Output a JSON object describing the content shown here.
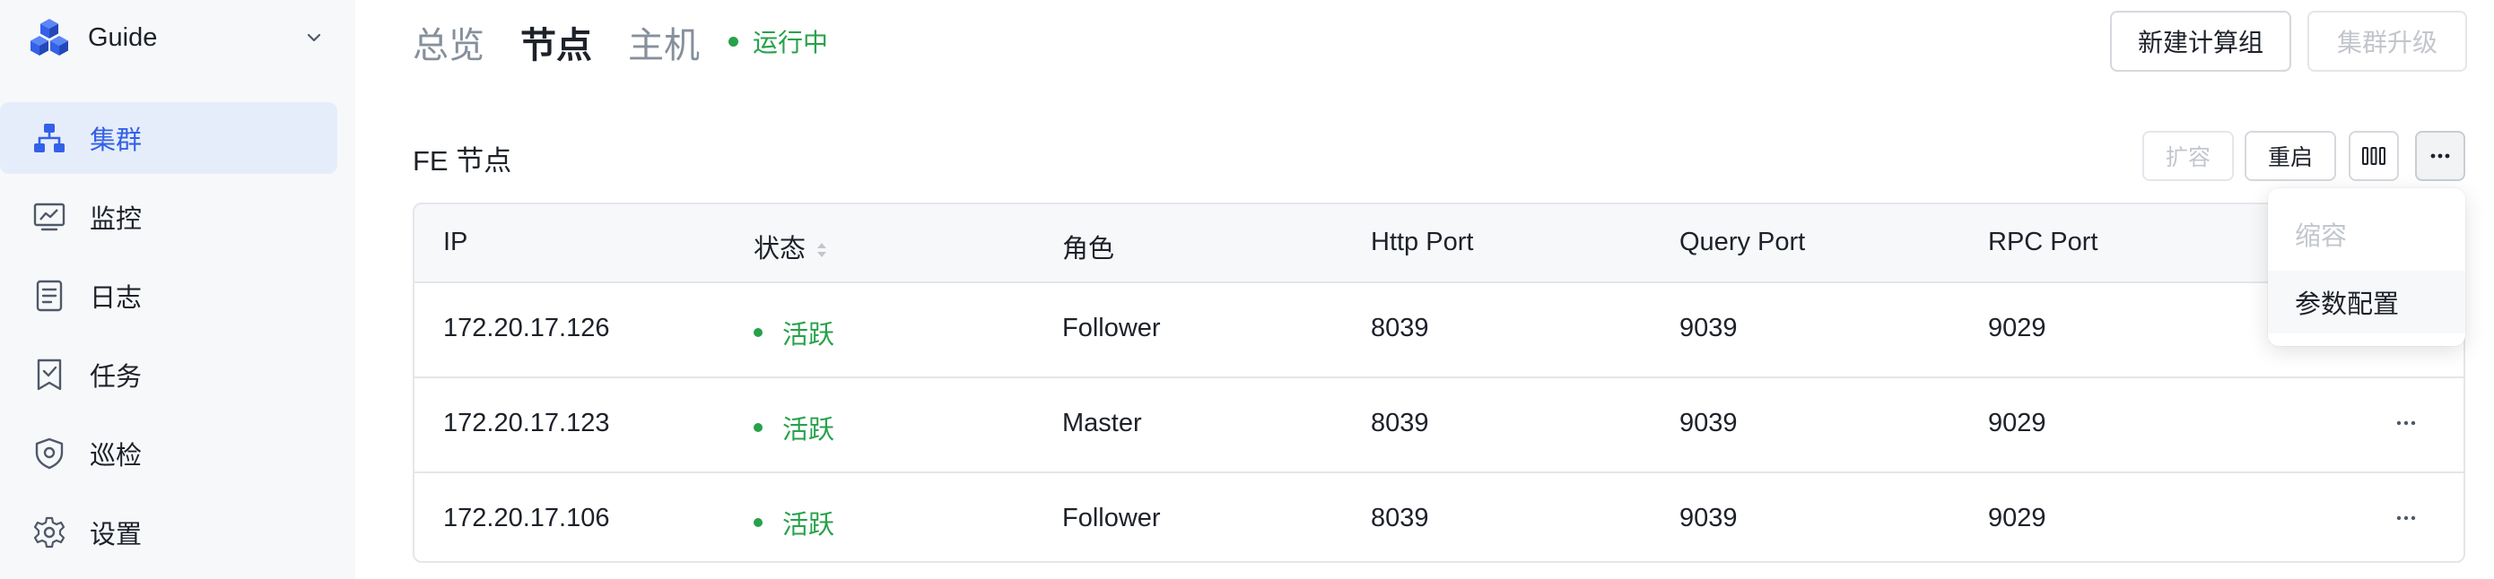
{
  "brand": {
    "name": "Guide",
    "icon": "cubes-logo-icon"
  },
  "sidebar": {
    "items": [
      {
        "label": "集群",
        "icon": "cluster-icon",
        "active": true
      },
      {
        "label": "监控",
        "icon": "monitor-chart-icon",
        "active": false
      },
      {
        "label": "日志",
        "icon": "log-document-icon",
        "active": false
      },
      {
        "label": "任务",
        "icon": "task-bookmark-icon",
        "active": false
      },
      {
        "label": "巡检",
        "icon": "inspection-shield-icon",
        "active": false
      },
      {
        "label": "设置",
        "icon": "gear-icon",
        "active": false
      }
    ]
  },
  "header": {
    "tabs": [
      {
        "label": "总览",
        "active": false
      },
      {
        "label": "节点",
        "active": true
      },
      {
        "label": "主机",
        "active": false
      }
    ],
    "status": "运行中",
    "buttons": {
      "new_compute_group": "新建计算组",
      "upgrade_cluster": "集群升级"
    }
  },
  "section": {
    "title": "FE 节点",
    "actions": {
      "scale_out": "扩容",
      "restart": "重启",
      "columns_icon": "columns-icon",
      "more_icon": "more-icon"
    }
  },
  "table": {
    "columns": [
      "IP",
      "状态",
      "角色",
      "Http Port",
      "Query Port",
      "RPC Port"
    ],
    "rows": [
      {
        "ip": "172.20.17.126",
        "status": "活跃",
        "role": "Follower",
        "http_port": "8039",
        "query_port": "9039",
        "rpc_port": "9029"
      },
      {
        "ip": "172.20.17.123",
        "status": "活跃",
        "role": "Master",
        "http_port": "8039",
        "query_port": "9039",
        "rpc_port": "9029"
      },
      {
        "ip": "172.20.17.106",
        "status": "活跃",
        "role": "Follower",
        "http_port": "8039",
        "query_port": "9039",
        "rpc_port": "9029"
      }
    ]
  },
  "dropdown": {
    "items": [
      {
        "label": "缩容",
        "disabled": true
      },
      {
        "label": "参数配置",
        "disabled": false
      }
    ]
  },
  "colors": {
    "accent": "#3361e8",
    "active_bg": "#e6edfa",
    "success": "#27a24a",
    "muted": "#86909c"
  }
}
